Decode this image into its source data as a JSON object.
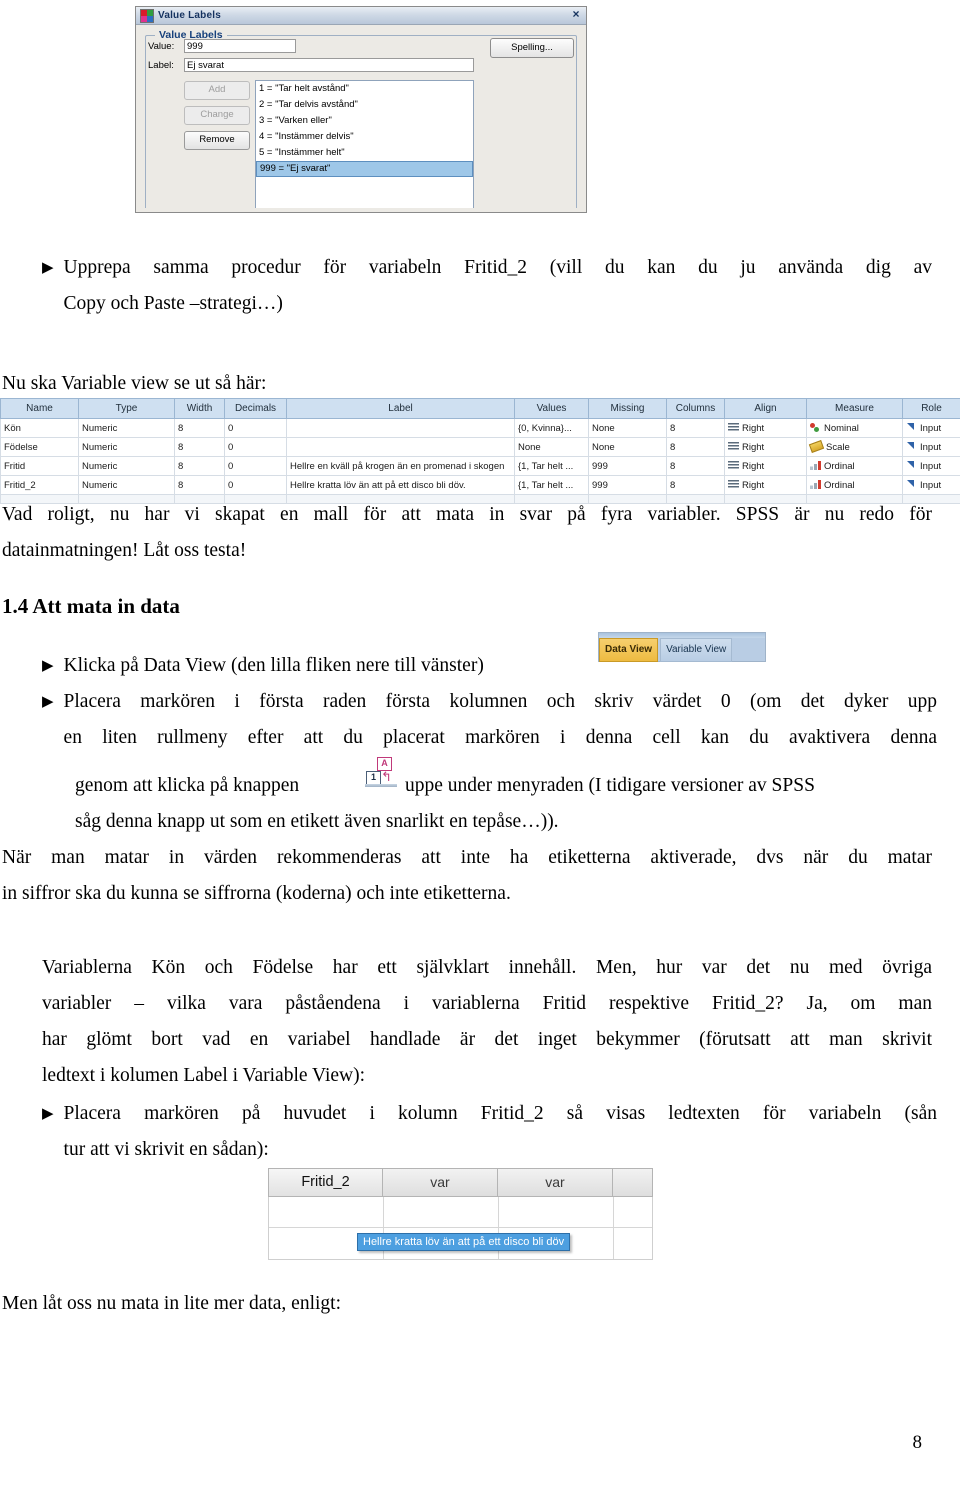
{
  "dialog": {
    "title": "Value Labels",
    "app_icon": "spss-icon",
    "close": "×",
    "group_title": "Value Labels",
    "value_label": "Value:",
    "value_text": "999",
    "label_label": "Label:",
    "label_text": "Ej svarat",
    "spelling_button": "Spelling...",
    "buttons": [
      {
        "label": "Add",
        "disabled": true
      },
      {
        "label": "Change",
        "disabled": true
      },
      {
        "label": "Remove",
        "disabled": false
      }
    ],
    "list_items": [
      {
        "text": "1 = \"Tar helt avstånd\"",
        "selected": false
      },
      {
        "text": "2 = \"Tar delvis avstånd\"",
        "selected": false
      },
      {
        "text": "3 = \"Varken eller\"",
        "selected": false
      },
      {
        "text": "4 = \"Instämmer delvis\"",
        "selected": false
      },
      {
        "text": "5 = \"Instämmer helt\"",
        "selected": false
      },
      {
        "text": "999 = \"Ej svarat\"",
        "selected": true
      }
    ]
  },
  "body": {
    "p1_line1": "Upprepa samma procedur för variabeln Fritid_2 (vill du kan du ju använda dig av",
    "p1_line2": "Copy och Paste –strategi…)",
    "p2": "Nu ska Variable view se ut så här:",
    "p3_line1": "Vad roligt, nu har vi skapat en mall för att mata in svar på fyra variabler. SPSS är nu redo för",
    "p3_line2": "datainmatningen! Låt oss testa!",
    "heading": "1.4 Att mata in data",
    "p4": "Klicka på Data View (den lilla fliken nere till vänster)",
    "p5_line1": "Placera markören i första raden första kolumnen och skriv värdet 0 (om det dyker upp",
    "p5_line2": "en liten rullmeny efter att du placerat markören i denna cell kan du avaktivera denna",
    "p5_line3a": "genom att klicka på knappen",
    "p5_line3b": "uppe under menyraden (I tidigare versioner av SPSS",
    "p5_line4": "såg denna knapp ut som en etikett även snarlikt en tepåse…)).",
    "p6_line1": "När man matar in värden rekommenderas att inte ha etiketterna aktiverade, dvs när du matar",
    "p6_line2": "in siffror ska du kunna se siffrorna (koderna) och inte etiketterna.",
    "p7_line1": "Variablerna Kön och Födelse har ett självklart innehåll. Men, hur var det nu med övriga",
    "p7_line2": "variabler – vilka vara påståendena i variablerna Fritid respektive Fritid_2? Ja, om man",
    "p7_line3": "har glömt bort vad en variabel handlade är det inget bekymmer (förutsatt att man skrivit",
    "p7_line4": "ledtext i kolumen Label i Variable View):",
    "p8_line1": "Placera markören på huvudet i kolumn Fritid_2 så visas ledtexten för variabeln (sån",
    "p8_line2": "tur att vi skrivit en sådan):",
    "p9": "Men låt oss nu mata in lite mer data, enligt:",
    "bullet_glyph": "▶",
    "page_number": "8"
  },
  "variable_view": {
    "columns": [
      "Name",
      "Type",
      "Width",
      "Decimals",
      "Label",
      "Values",
      "Missing",
      "Columns",
      "Align",
      "Measure",
      "Role"
    ],
    "rows": [
      {
        "Name": "Kön",
        "Type": "Numeric",
        "Width": "8",
        "Decimals": "0",
        "Label": "",
        "Values": "{0, Kvinna}...",
        "Missing": "None",
        "Columns": "8",
        "Align": "Right",
        "Measure": "Nominal",
        "Role": "Input",
        "measure_icon": "nominal-icon"
      },
      {
        "Name": "Födelse",
        "Type": "Numeric",
        "Width": "8",
        "Decimals": "0",
        "Label": "",
        "Values": "None",
        "Missing": "None",
        "Columns": "8",
        "Align": "Right",
        "Measure": "Scale",
        "Role": "Input",
        "measure_icon": "scale-icon"
      },
      {
        "Name": "Fritid",
        "Type": "Numeric",
        "Width": "8",
        "Decimals": "0",
        "Label": "Hellre en kväll på krogen än en promenad i skogen",
        "Values": "{1, Tar helt ...",
        "Missing": "999",
        "Columns": "8",
        "Align": "Right",
        "Measure": "Ordinal",
        "Role": "Input",
        "measure_icon": "ordinal-icon"
      },
      {
        "Name": "Fritid_2",
        "Type": "Numeric",
        "Width": "8",
        "Decimals": "0",
        "Label": "Hellre kratta löv än att på ett disco bli döv.",
        "Values": "{1, Tar helt ...",
        "Missing": "999",
        "Columns": "8",
        "Align": "Right",
        "Measure": "Ordinal",
        "Role": "Input",
        "measure_icon": "ordinal-icon"
      }
    ]
  },
  "view_tabs": {
    "data_view": "Data View",
    "variable_view": "Variable View",
    "active": "Data View"
  },
  "value_labels_button": {
    "letter": "A",
    "digit": "1",
    "arrow": "↰"
  },
  "data_grid": {
    "headers": [
      "Fritid_2",
      "var",
      "var",
      ""
    ],
    "tooltip": "Hellre kratta löv än att på ett disco bli döv"
  },
  "colors": {
    "header_blue": "#cfe0f1",
    "selection_blue": "#9ec7e8",
    "tooltip_blue": "#4d9fe0",
    "tab_gold": "#eebb41",
    "dialog_bg": "#eceae5"
  }
}
